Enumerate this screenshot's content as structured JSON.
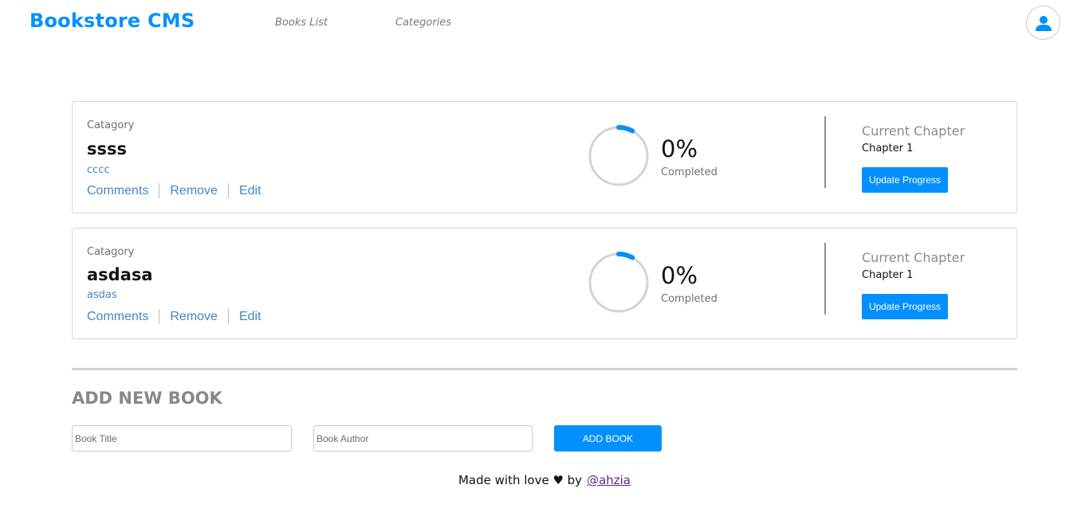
{
  "header": {
    "logo": "Bookstore CMS",
    "nav": [
      {
        "label": "Books List"
      },
      {
        "label": "Categories"
      }
    ],
    "avatar_icon": "user-icon"
  },
  "books": [
    {
      "category": "Catagory",
      "title": "ssss",
      "author": "cccc",
      "actions": [
        "Comments",
        "Remove",
        "Edit"
      ],
      "progress_value": 0.08,
      "percent": "0%",
      "completed_label": "Completed",
      "chapter_heading": "Current Chapter",
      "chapter": "Chapter 1",
      "update_label": "Update Progress"
    },
    {
      "category": "Catagory",
      "title": "asdasa",
      "author": "asdas",
      "actions": [
        "Comments",
        "Remove",
        "Edit"
      ],
      "progress_value": 0.08,
      "percent": "0%",
      "completed_label": "Completed",
      "chapter_heading": "Current Chapter",
      "chapter": "Chapter 1",
      "update_label": "Update Progress"
    }
  ],
  "form": {
    "title": "ADD NEW BOOK",
    "title_placeholder": "Book Title",
    "author_placeholder": "Book Author",
    "submit_label": "ADD BOOK"
  },
  "footer": {
    "text": "Made with love ♥ by",
    "link": "@ahzia"
  },
  "colors": {
    "accent": "#0290ff",
    "link": "#4386bf"
  }
}
